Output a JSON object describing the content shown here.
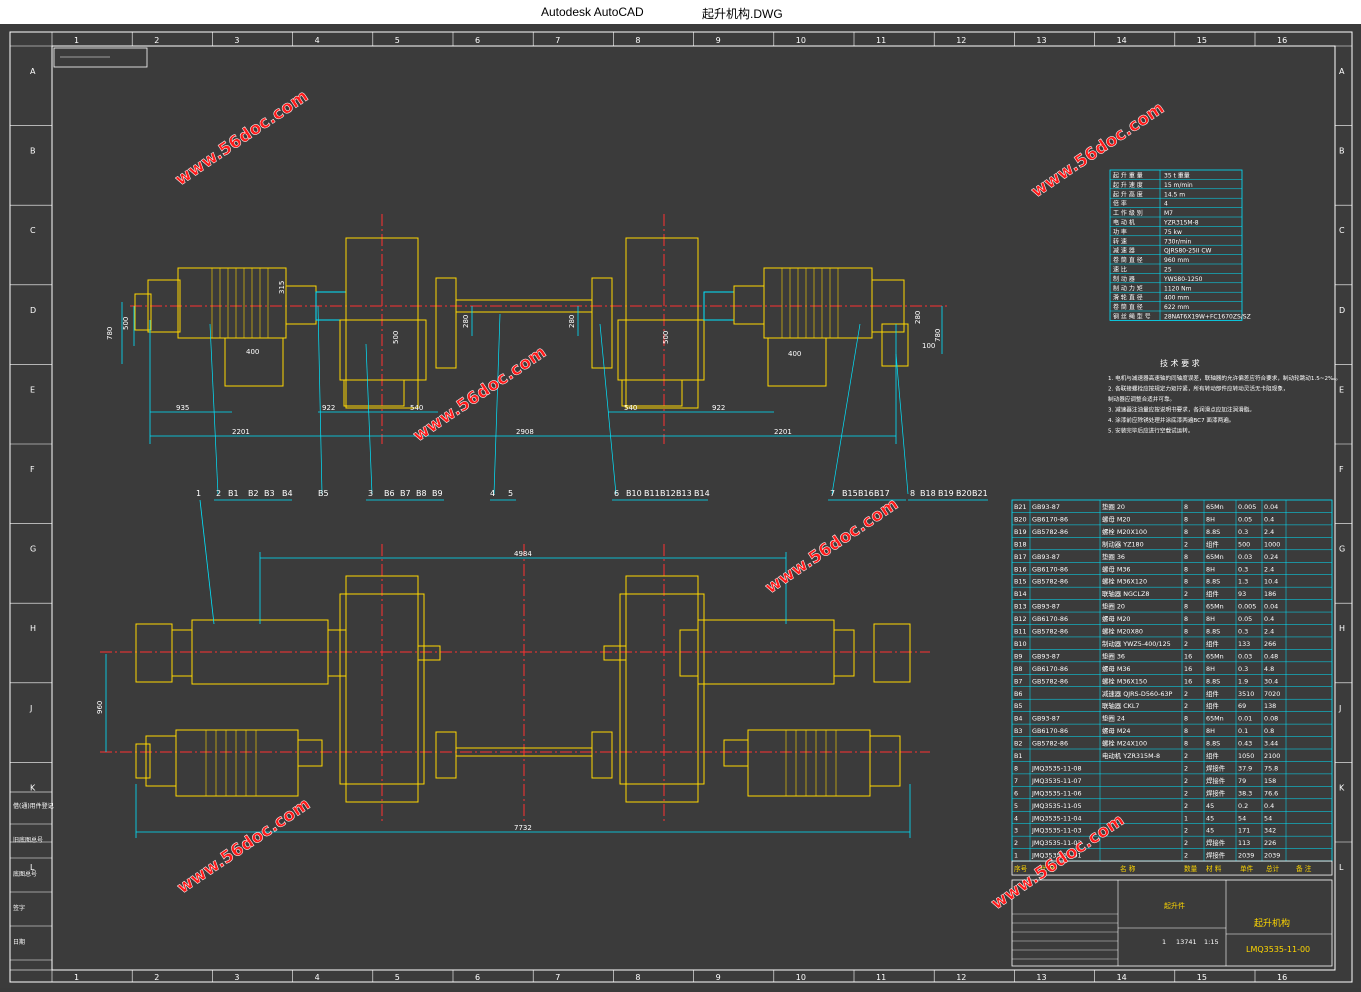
{
  "window": {
    "app_name": "Autodesk AutoCAD",
    "file_name": "起升机构.DWG"
  },
  "frame": {
    "column_numbers": [
      "1",
      "2",
      "3",
      "4",
      "5",
      "6",
      "7",
      "8",
      "9",
      "10",
      "11",
      "12",
      "13",
      "14",
      "15",
      "16"
    ],
    "row_letters": [
      "A",
      "B",
      "C",
      "D",
      "E",
      "F",
      "G",
      "H",
      "J",
      "K",
      "L"
    ]
  },
  "watermarks": [
    "www.56doc.com",
    "www.56doc.com",
    "www.56doc.com",
    "www.56doc.com",
    "www.56doc.com",
    "www.56doc.com"
  ],
  "top_view": {
    "dims_bottom": [
      "935",
      "922",
      "540",
      "540",
      "922",
      "2201",
      "2908",
      "2201"
    ],
    "dims_vertical": [
      "780",
      "500",
      "315",
      "280",
      "280",
      "500",
      "500",
      "280",
      "780",
      "100"
    ],
    "dims_small": [
      "400",
      "400"
    ],
    "callouts_left": [
      "1",
      "2",
      "B1",
      "B2",
      "B3",
      "B4",
      "B5",
      "3",
      "B6",
      "B7",
      "B8",
      "B9",
      "4",
      "5"
    ],
    "callouts_right": [
      "6",
      "B10",
      "B11",
      "B12",
      "B13",
      "B14",
      "7",
      "B15",
      "B16",
      "B17",
      "8",
      "B18",
      "B19",
      "B20",
      "B21"
    ]
  },
  "bottom_view": {
    "dim_overall_top": "4984",
    "dim_vertical": "960",
    "dim_overall_bottom": "7732"
  },
  "spec_table": {
    "rows": [
      [
        "起 升 重 量",
        "35 t 重量"
      ],
      [
        "起 升 速 度",
        "15 m/min"
      ],
      [
        "起 升 高 度",
        "14.5 m"
      ],
      [
        "倍 率",
        "4"
      ],
      [
        "工 作 级 别",
        "M7"
      ],
      [
        "电 动 机",
        "YZR315M-8"
      ],
      [
        "功 率",
        "75 kw"
      ],
      [
        "转 速",
        "730r/min"
      ],
      [
        "减 速 器",
        "QJRS80-25II CW"
      ],
      [
        "卷 筒 直 径",
        "960 mm"
      ],
      [
        "速 比",
        "25"
      ],
      [
        "制 动 器",
        "YWS80-1250"
      ],
      [
        "制 动 力 矩",
        "1120 Nm"
      ],
      [
        "滑 轮 直 径",
        "400 mm"
      ],
      [
        "卷 筒 直 径",
        "622 mm"
      ],
      [
        "钢 丝 绳 型 号",
        "28NAT6X19W+FC1670ZS/SZ"
      ]
    ]
  },
  "tech_notes": {
    "title": "技 术 要 求",
    "items": [
      "1. 电机与减速器高速轴的同轴度误差，联轴器的允许偏差应符合要求，制动轮跳动1.5~2‰。",
      "2. 各联接螺栓应按规定力矩拧紧，所有转动部件应转动灵活无卡阻现象，",
      "   制动器应调整合适并可靠。",
      "3. 减速器注油量应按说明书要求，各润滑点应加注润滑脂。",
      "4. 涂漆前应除锈处理并涂底漆两遍BC7 面漆两遍。",
      "5. 安装完毕后应进行空载试运转。"
    ]
  },
  "bom": {
    "rows": [
      [
        "B21",
        "GB93-87",
        "垫圈 20",
        "8",
        "65Mn",
        "0.005",
        "0.04"
      ],
      [
        "B20",
        "GB6170-86",
        "螺母 M20",
        "8",
        "8H",
        "0.05",
        "0.4"
      ],
      [
        "B19",
        "GB5782-86",
        "螺栓 M20X100",
        "8",
        "8.8S",
        "0.3",
        "2.4"
      ],
      [
        "B18",
        "",
        "制动器 YZ180",
        "2",
        "组件",
        "500",
        "1000"
      ],
      [
        "B17",
        "GB93-87",
        "垫圈 36",
        "8",
        "65Mn",
        "0.03",
        "0.24"
      ],
      [
        "B16",
        "GB6170-86",
        "螺母 M36",
        "8",
        "8H",
        "0.3",
        "2.4"
      ],
      [
        "B15",
        "GB5782-86",
        "螺栓 M36X120",
        "8",
        "8.8S",
        "1.3",
        "10.4"
      ],
      [
        "B14",
        "",
        "联轴器 NGCLZ8",
        "2",
        "组件",
        "93",
        "186"
      ],
      [
        "B13",
        "GB93-87",
        "垫圈 20",
        "8",
        "65Mn",
        "0.005",
        "0.04"
      ],
      [
        "B12",
        "GB6170-86",
        "螺母 M20",
        "8",
        "8H",
        "0.05",
        "0.4"
      ],
      [
        "B11",
        "GB5782-86",
        "螺栓 M20X80",
        "8",
        "8.8S",
        "0.3",
        "2.4"
      ],
      [
        "B10",
        "",
        "制动器 YWZ5-400/125",
        "2",
        "组件",
        "133",
        "266"
      ],
      [
        "B9",
        "GB93-87",
        "垫圈 36",
        "16",
        "65Mn",
        "0.03",
        "0.48"
      ],
      [
        "B8",
        "GB6170-86",
        "螺母 M36",
        "16",
        "8H",
        "0.3",
        "4.8"
      ],
      [
        "B7",
        "GB5782-86",
        "螺栓 M36X150",
        "16",
        "8.8S",
        "1.9",
        "30.4"
      ],
      [
        "B6",
        "",
        "减速器 QJRS-D560-63P",
        "2",
        "组件",
        "3510",
        "7020"
      ],
      [
        "B5",
        "",
        "联轴器 CKL7",
        "2",
        "组件",
        "69",
        "138"
      ],
      [
        "B4",
        "GB93-87",
        "垫圈 24",
        "8",
        "65Mn",
        "0.01",
        "0.08"
      ],
      [
        "B3",
        "GB6170-86",
        "螺母 M24",
        "8",
        "8H",
        "0.1",
        "0.8"
      ],
      [
        "B2",
        "GB5782-86",
        "螺栓 M24X100",
        "8",
        "8.8S",
        "0.43",
        "3.44"
      ],
      [
        "B1",
        "",
        "电动机 YZR315M-8",
        "2",
        "组件",
        "1050",
        "2100"
      ],
      [
        "8",
        "JMQ3535-11-08",
        "",
        "2",
        "焊接件",
        "37.9",
        "75.8"
      ],
      [
        "7",
        "JMQ3535-11-07",
        "",
        "2",
        "焊接件",
        "79",
        "158"
      ],
      [
        "6",
        "JMQ3535-11-06",
        "",
        "2",
        "焊接件",
        "38.3",
        "76.6"
      ],
      [
        "5",
        "JMQ3535-11-05",
        "",
        "2",
        "45",
        "0.2",
        "0.4"
      ],
      [
        "4",
        "JMQ3535-11-04",
        "",
        "1",
        "45",
        "54",
        "54"
      ],
      [
        "3",
        "JMQ3535-11-03",
        "",
        "2",
        "45",
        "171",
        "342"
      ],
      [
        "2",
        "JMQ3535-11-02",
        "",
        "2",
        "焊接件",
        "113",
        "226"
      ],
      [
        "1",
        "JMQ3535-11-01",
        "",
        "2",
        "焊接件",
        "2039",
        "2039"
      ]
    ],
    "header": [
      "序号",
      "代 号",
      "名 称",
      "数量",
      "材 料",
      "单件",
      "总计",
      "备 注"
    ]
  },
  "title_block": {
    "assembly": "起升机构",
    "drawing_no": "LMQ3535-11-00",
    "sub_title": "起升件",
    "qty": "1",
    "weight": "13741",
    "scale": "1:15"
  },
  "left_side_labels": [
    "借(通)用件登记",
    "旧底图总号",
    "底图总号",
    "签字",
    "日期"
  ]
}
